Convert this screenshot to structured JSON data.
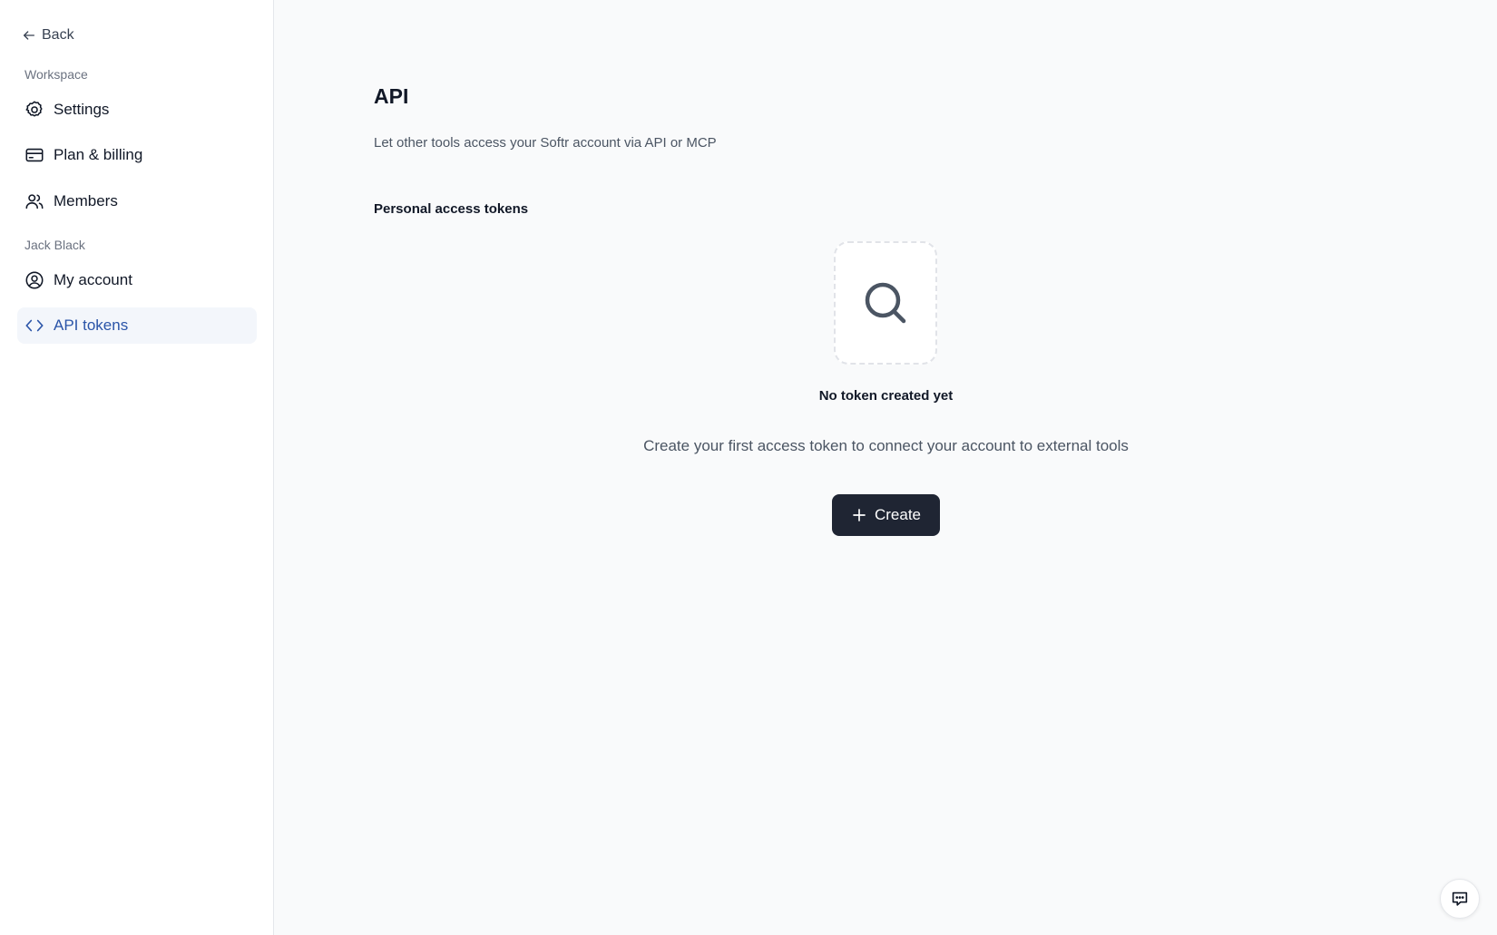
{
  "sidebar": {
    "back_label": "Back",
    "workspace_label": "Workspace",
    "user_label": "Jack Black",
    "items": {
      "settings": "Settings",
      "billing": "Plan & billing",
      "members": "Members",
      "account": "My account",
      "api_tokens": "API tokens"
    },
    "active_item": "api_tokens",
    "active_color": "#2a54a8"
  },
  "main": {
    "title": "API",
    "subtitle": "Let other tools access your Softr account via API or MCP",
    "section_title": "Personal access tokens",
    "empty_state": {
      "icon": "search-icon",
      "title": "No token created yet",
      "description": "Create your first access token to connect your account to external tools"
    },
    "create_button": {
      "label": "Create",
      "icon": "plus-icon"
    }
  },
  "chat": {
    "icon": "chat-icon"
  }
}
